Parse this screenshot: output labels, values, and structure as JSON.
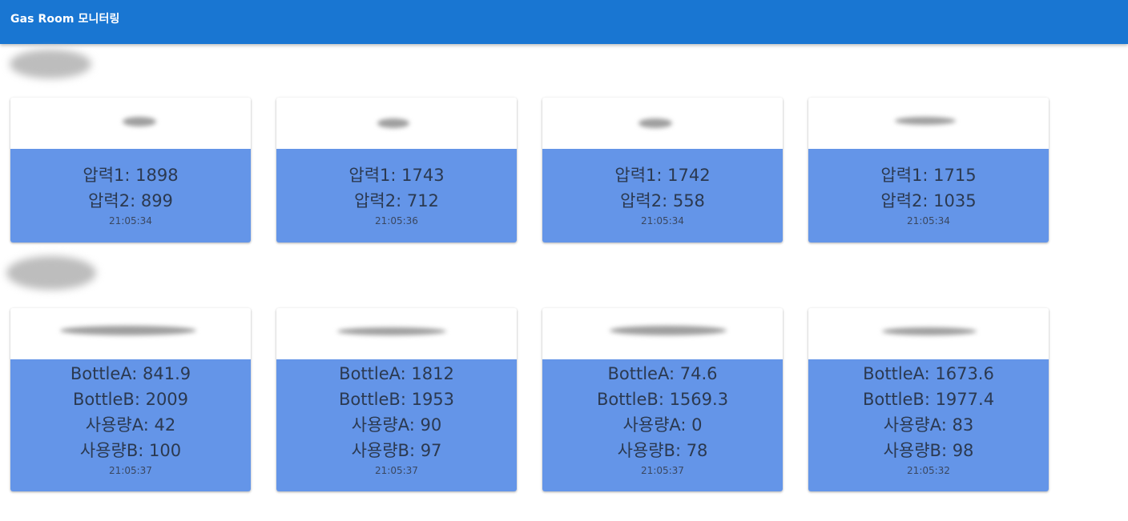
{
  "app": {
    "title": "Gas Room 모니터링"
  },
  "pressure_cards": [
    {
      "line1": "압력1: 1898",
      "line2": "압력2: 899",
      "time": "21:05:34"
    },
    {
      "line1": "압력1: 1743",
      "line2": "압력2: 712",
      "time": "21:05:36"
    },
    {
      "line1": "압력1: 1742",
      "line2": "압력2: 558",
      "time": "21:05:34"
    },
    {
      "line1": "압력1: 1715",
      "line2": "압력2: 1035",
      "time": "21:05:34"
    }
  ],
  "bottle_cards": [
    {
      "line1": "BottleA: 841.9",
      "line2": "BottleB: 2009",
      "line3": "사용량A: 42",
      "line4": "사용량B: 100",
      "time": "21:05:37"
    },
    {
      "line1": "BottleA: 1812",
      "line2": "BottleB: 1953",
      "line3": "사용량A: 90",
      "line4": "사용량B: 97",
      "time": "21:05:37"
    },
    {
      "line1": "BottleA: 74.6",
      "line2": "BottleB: 1569.3",
      "line3": "사용량A: 0",
      "line4": "사용량B: 78",
      "time": "21:05:37"
    },
    {
      "line1": "BottleA: 1673.6",
      "line2": "BottleB: 1977.4",
      "line3": "사용량A: 83",
      "line4": "사용량B: 98",
      "time": "21:05:32"
    }
  ],
  "colors": {
    "appbar": "#1976d2",
    "card_body": "#6495e8"
  }
}
